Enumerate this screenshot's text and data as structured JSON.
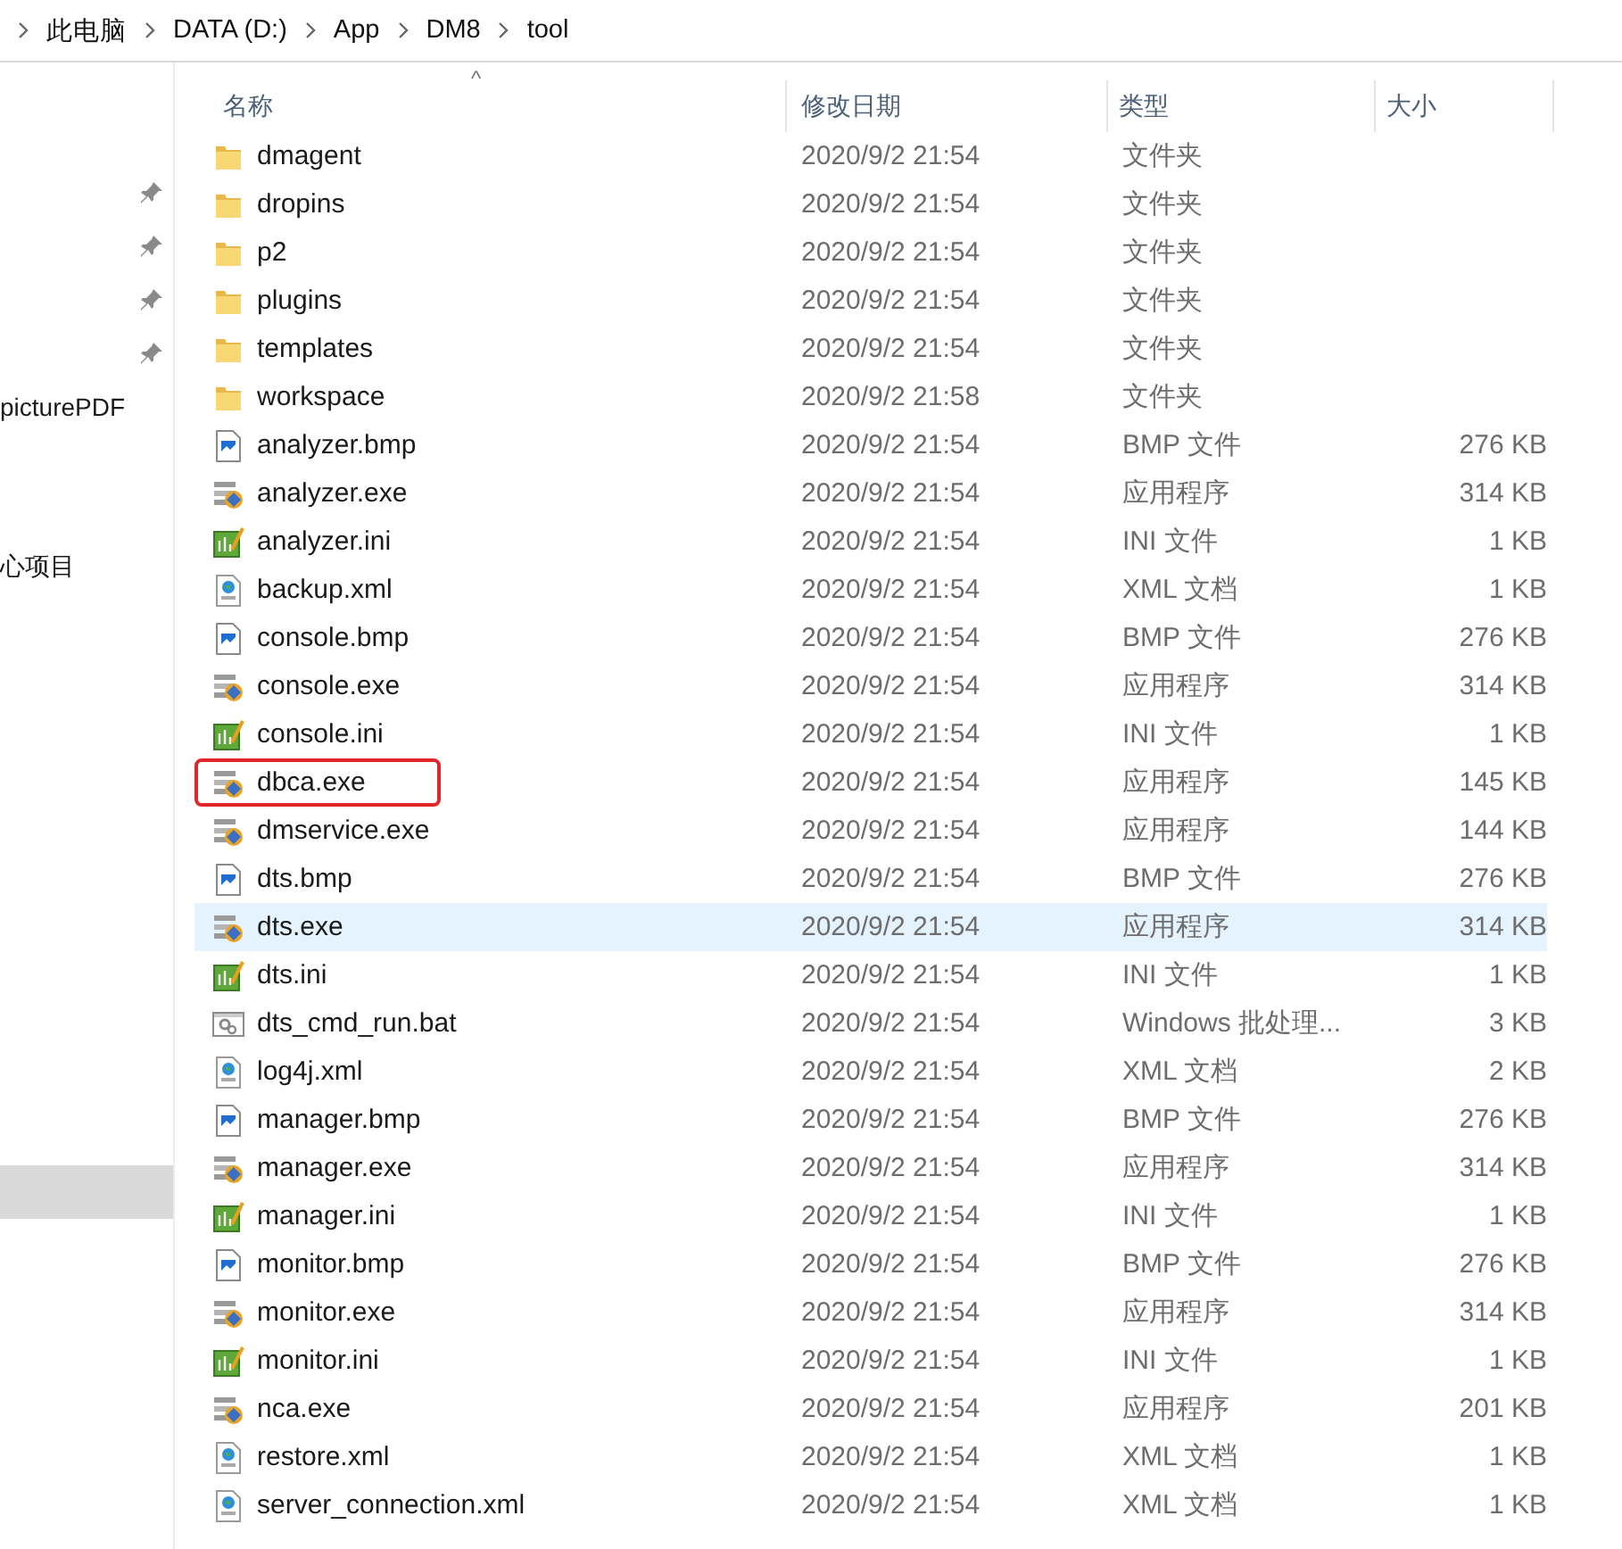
{
  "breadcrumb": [
    "此电脑",
    "DATA (D:)",
    "App",
    "DM8",
    "tool"
  ],
  "nav": {
    "items": [
      {
        "kind": "pin"
      },
      {
        "kind": "pin"
      },
      {
        "kind": "pin"
      },
      {
        "kind": "pin"
      },
      {
        "kind": "text",
        "label": "picturePDF"
      },
      {
        "kind": "spacer"
      },
      {
        "kind": "spacer"
      },
      {
        "kind": "text",
        "label": "心项目"
      },
      {
        "kind": "blank",
        "selected": true
      }
    ]
  },
  "columns": [
    "名称",
    "修改日期",
    "类型",
    "大小"
  ],
  "sort_indicator": "^",
  "rows": [
    {
      "kind": "folder",
      "name": "dmagent",
      "date": "2020/9/2 21:54",
      "type": "文件夹",
      "selected": false,
      "highlighted": false
    },
    {
      "kind": "folder",
      "name": "dropins",
      "date": "2020/9/2 21:54",
      "type": "文件夹",
      "selected": false,
      "highlighted": false
    },
    {
      "kind": "folder",
      "name": "p2",
      "date": "2020/9/2 21:54",
      "type": "文件夹",
      "selected": false,
      "highlighted": false
    },
    {
      "kind": "folder",
      "name": "plugins",
      "date": "2020/9/2 21:54",
      "type": "文件夹",
      "selected": false,
      "highlighted": false
    },
    {
      "kind": "folder",
      "name": "templates",
      "date": "2020/9/2 21:54",
      "type": "文件夹",
      "selected": false,
      "highlighted": false
    },
    {
      "kind": "folder",
      "name": "workspace",
      "date": "2020/9/2 21:58",
      "type": "文件夹",
      "selected": false,
      "highlighted": false
    },
    {
      "kind": "bmp",
      "name": "analyzer.bmp",
      "date": "2020/9/2 21:54",
      "type": "BMP 文件",
      "size": "276 KB",
      "selected": false,
      "highlighted": false
    },
    {
      "kind": "exe",
      "name": "analyzer.exe",
      "date": "2020/9/2 21:54",
      "type": "应用程序",
      "size": "314 KB",
      "selected": false,
      "highlighted": false
    },
    {
      "kind": "ini",
      "name": "analyzer.ini",
      "date": "2020/9/2 21:54",
      "type": "INI 文件",
      "size": "1 KB",
      "selected": false,
      "highlighted": false
    },
    {
      "kind": "xml",
      "name": "backup.xml",
      "date": "2020/9/2 21:54",
      "type": "XML 文档",
      "size": "1 KB",
      "selected": false,
      "highlighted": false
    },
    {
      "kind": "bmp",
      "name": "console.bmp",
      "date": "2020/9/2 21:54",
      "type": "BMP 文件",
      "size": "276 KB",
      "selected": false,
      "highlighted": false
    },
    {
      "kind": "exe",
      "name": "console.exe",
      "date": "2020/9/2 21:54",
      "type": "应用程序",
      "size": "314 KB",
      "selected": false,
      "highlighted": false
    },
    {
      "kind": "ini",
      "name": "console.ini",
      "date": "2020/9/2 21:54",
      "type": "INI 文件",
      "size": "1 KB",
      "selected": false,
      "highlighted": false
    },
    {
      "kind": "exe",
      "name": "dbca.exe",
      "date": "2020/9/2 21:54",
      "type": "应用程序",
      "size": "145 KB",
      "selected": false,
      "highlighted": true
    },
    {
      "kind": "exe",
      "name": "dmservice.exe",
      "date": "2020/9/2 21:54",
      "type": "应用程序",
      "size": "144 KB",
      "selected": false,
      "highlighted": false
    },
    {
      "kind": "bmp",
      "name": "dts.bmp",
      "date": "2020/9/2 21:54",
      "type": "BMP 文件",
      "size": "276 KB",
      "selected": false,
      "highlighted": false
    },
    {
      "kind": "exe",
      "name": "dts.exe",
      "date": "2020/9/2 21:54",
      "type": "应用程序",
      "size": "314 KB",
      "selected": true,
      "highlighted": false
    },
    {
      "kind": "ini",
      "name": "dts.ini",
      "date": "2020/9/2 21:54",
      "type": "INI 文件",
      "size": "1 KB",
      "selected": false,
      "highlighted": false
    },
    {
      "kind": "bat",
      "name": "dts_cmd_run.bat",
      "date": "2020/9/2 21:54",
      "type": "Windows 批处理...",
      "size": "3 KB",
      "selected": false,
      "highlighted": false
    },
    {
      "kind": "xml",
      "name": "log4j.xml",
      "date": "2020/9/2 21:54",
      "type": "XML 文档",
      "size": "2 KB",
      "selected": false,
      "highlighted": false
    },
    {
      "kind": "bmp",
      "name": "manager.bmp",
      "date": "2020/9/2 21:54",
      "type": "BMP 文件",
      "size": "276 KB",
      "selected": false,
      "highlighted": false
    },
    {
      "kind": "exe",
      "name": "manager.exe",
      "date": "2020/9/2 21:54",
      "type": "应用程序",
      "size": "314 KB",
      "selected": false,
      "highlighted": false
    },
    {
      "kind": "ini",
      "name": "manager.ini",
      "date": "2020/9/2 21:54",
      "type": "INI 文件",
      "size": "1 KB",
      "selected": false,
      "highlighted": false
    },
    {
      "kind": "bmp",
      "name": "monitor.bmp",
      "date": "2020/9/2 21:54",
      "type": "BMP 文件",
      "size": "276 KB",
      "selected": false,
      "highlighted": false
    },
    {
      "kind": "exe",
      "name": "monitor.exe",
      "date": "2020/9/2 21:54",
      "type": "应用程序",
      "size": "314 KB",
      "selected": false,
      "highlighted": false
    },
    {
      "kind": "ini",
      "name": "monitor.ini",
      "date": "2020/9/2 21:54",
      "type": "INI 文件",
      "size": "1 KB",
      "selected": false,
      "highlighted": false
    },
    {
      "kind": "exe",
      "name": "nca.exe",
      "date": "2020/9/2 21:54",
      "type": "应用程序",
      "size": "201 KB",
      "selected": false,
      "highlighted": false
    },
    {
      "kind": "xml",
      "name": "restore.xml",
      "date": "2020/9/2 21:54",
      "type": "XML 文档",
      "size": "1 KB",
      "selected": false,
      "highlighted": false
    },
    {
      "kind": "xml",
      "name": "server_connection.xml",
      "date": "2020/9/2 21:54",
      "type": "XML 文档",
      "size": "1 KB",
      "selected": false,
      "highlighted": false
    }
  ]
}
